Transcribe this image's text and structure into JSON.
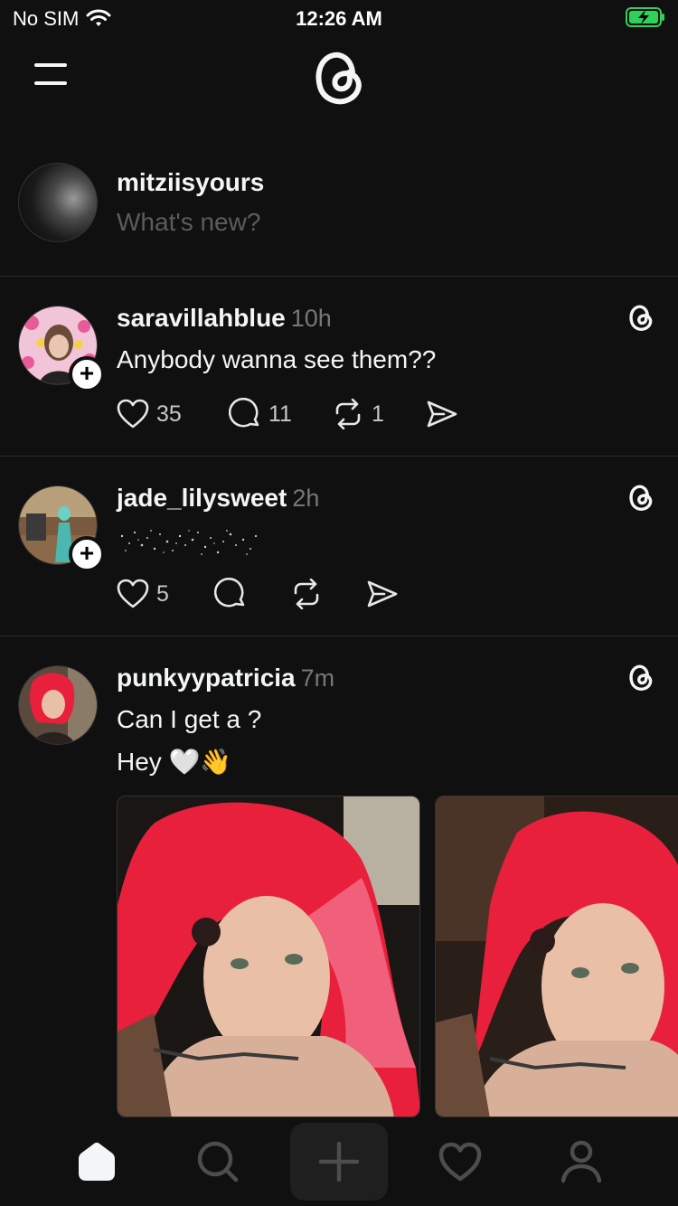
{
  "status_bar": {
    "carrier": "No SIM",
    "time": "12:26 AM",
    "battery_color": "#30d158"
  },
  "composer": {
    "username": "mitziisyours",
    "placeholder": "What's new?"
  },
  "posts": [
    {
      "username": "saravillahblue",
      "time_ago": "10h",
      "text": "Anybody wanna see them??",
      "likes": "35",
      "replies": "11",
      "reposts": "1"
    },
    {
      "username": "jade_lilysweet",
      "time_ago": "2h",
      "likes": "5"
    },
    {
      "username": "punkyypatricia",
      "time_ago": "7m",
      "text_line1": "Can I get a ?",
      "text_line2": "Hey 🤍👋"
    }
  ],
  "icons": {
    "menu": "menu-icon",
    "logo": "threads-logo-icon",
    "like": "heart-icon",
    "reply": "comment-icon",
    "repost": "repost-icon",
    "share": "send-icon",
    "tabs": [
      "home-icon",
      "search-icon",
      "plus-icon",
      "heart-icon",
      "profile-icon"
    ]
  }
}
